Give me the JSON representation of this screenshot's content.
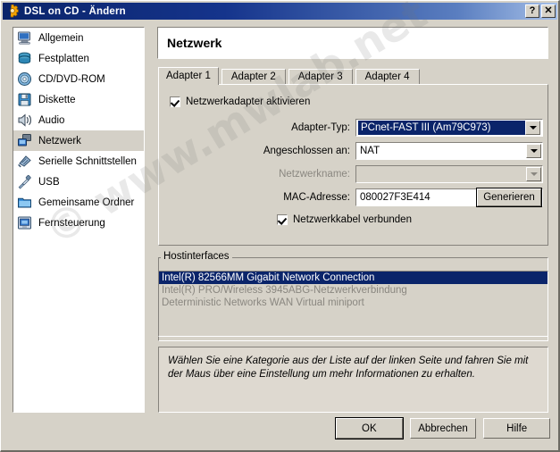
{
  "window": {
    "title": "DSL on CD - Ändern",
    "icon": "gear-icon",
    "help_button": "?",
    "close_button": "✕"
  },
  "colors": {
    "titlebar_start": "#0a246a",
    "titlebar_end": "#a6c0e8",
    "face": "#d6d2c8",
    "selection": "#0a246a",
    "sidebar_selection": "#d4d0c7",
    "disabled_text": "#8a8780",
    "info_bg": "#ded9d0"
  },
  "sidebar": {
    "items": [
      {
        "label": "Allgemein",
        "icon": "monitor-icon",
        "selected": false
      },
      {
        "label": "Festplatten",
        "icon": "harddisk-icon",
        "selected": false
      },
      {
        "label": "CD/DVD-ROM",
        "icon": "cd-icon",
        "selected": false
      },
      {
        "label": "Diskette",
        "icon": "floppy-icon",
        "selected": false
      },
      {
        "label": "Audio",
        "icon": "speaker-icon",
        "selected": false
      },
      {
        "label": "Netzwerk",
        "icon": "network-icon",
        "selected": true
      },
      {
        "label": "Serielle Schnittstellen",
        "icon": "serial-port-icon",
        "selected": false
      },
      {
        "label": "USB",
        "icon": "usb-plug-icon",
        "selected": false
      },
      {
        "label": "Gemeinsame Ordner",
        "icon": "folder-icon",
        "selected": false
      },
      {
        "label": "Fernsteuerung",
        "icon": "remote-display-icon",
        "selected": false
      }
    ]
  },
  "pane": {
    "title": "Netzwerk",
    "tabs": [
      {
        "label": "Adapter 1",
        "accel": "1",
        "active": true
      },
      {
        "label": "Adapter 2",
        "accel": "2",
        "active": false
      },
      {
        "label": "Adapter 3",
        "accel": "3",
        "active": false
      },
      {
        "label": "Adapter 4",
        "accel": "4",
        "active": false
      }
    ]
  },
  "adapter": {
    "enable_checkbox": {
      "label": "Netzwerkadapter aktivieren",
      "checked": true
    },
    "adapter_type": {
      "label": "Adapter-Typ:",
      "value": "PCnet-FAST III (Am79C973)",
      "focused": true
    },
    "attached_to": {
      "label": "Angeschlossen an:",
      "value": "NAT"
    },
    "network_name": {
      "label": "Netzwerkname:",
      "value": "",
      "disabled": true
    },
    "mac_address": {
      "label": "MAC-Adresse:",
      "value": "080027F3E414"
    },
    "generate_button": "Generieren",
    "cable_connected": {
      "label": "Netzwerkkabel verbunden",
      "checked": true
    }
  },
  "hostinterfaces": {
    "legend": "Hostinterfaces",
    "items": [
      {
        "label": "Intel(R) 82566MM Gigabit Network Connection",
        "selected": true
      },
      {
        "label": "Intel(R) PRO/Wireless 3945ABG-Netzwerkverbindung",
        "selected": false
      },
      {
        "label": "Deterministic Networks WAN Virtual miniport",
        "selected": false
      }
    ]
  },
  "info": {
    "text": "Wählen Sie eine Kategorie aus der Liste auf der linken Seite und fahren Sie mit der Maus über eine Einstellung um mehr Informationen zu erhalten."
  },
  "buttons": {
    "ok": "OK",
    "cancel": "Abbrechen",
    "help": "Hilfe"
  },
  "watermark": {
    "text": "© www.mwlab.net"
  }
}
